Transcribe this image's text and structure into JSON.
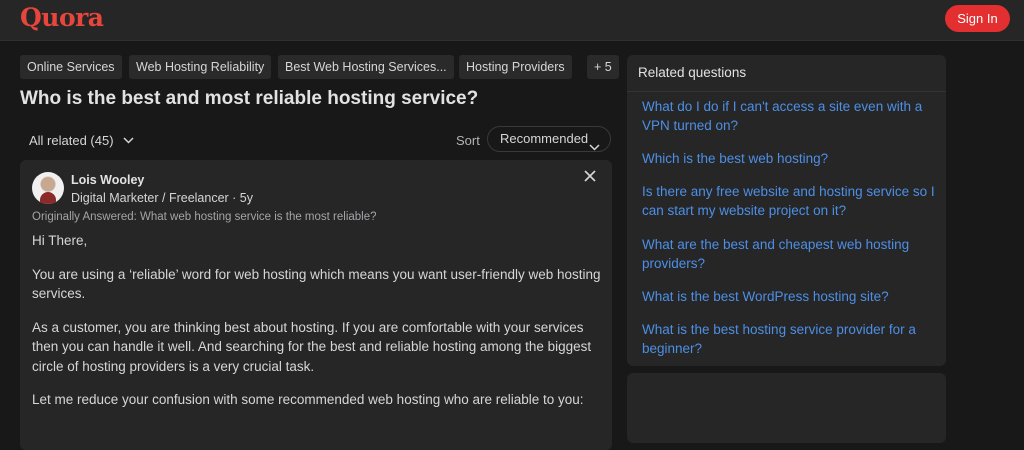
{
  "header": {
    "logo": "Quora",
    "signin_label": "Sign In"
  },
  "topics": [
    "Online Services",
    "Web Hosting Reliability",
    "Best Web Hosting Services...",
    "Hosting Providers",
    "+ 5"
  ],
  "question": {
    "title": "Who is the best and most reliable hosting service?"
  },
  "filters": {
    "all_related": "All related (45)",
    "sort_label": "Sort",
    "sort_value": "Recommended"
  },
  "answer": {
    "author": "Lois Wooley",
    "meta": "Digital Marketer / Freelancer · 5y",
    "originally_answered": "Originally Answered: What web hosting service is the most reliable?",
    "paragraphs": [
      "Hi There,",
      "You are using a ‘reliable’ word for web hosting which means you want user-friendly web hosting services.",
      "As a customer, you are thinking best about hosting. If you are comfortable with your services then you can handle it well. And searching for the best and reliable hosting among the biggest circle of hosting providers is a very crucial task.",
      "Let me reduce your confusion with some recommended web hosting who are reliable to you:"
    ]
  },
  "related": {
    "title": "Related questions",
    "items": [
      "What do I do if I can't access a site even with a VPN turned on?",
      "Which is the best web hosting?",
      "Is there any free website and hosting service so I can start my website project on it?",
      "What are the best and cheapest web hosting providers?",
      "What is the best WordPress hosting site?",
      "What is the best hosting service provider for a beginner?"
    ]
  },
  "colors": {
    "brand": "#e6463c",
    "signin": "#e32f2f",
    "link": "#4d8fe6",
    "background": "#181818",
    "card": "#262626"
  },
  "icons": [
    "chevron-down-icon",
    "close-icon",
    "avatar"
  ]
}
